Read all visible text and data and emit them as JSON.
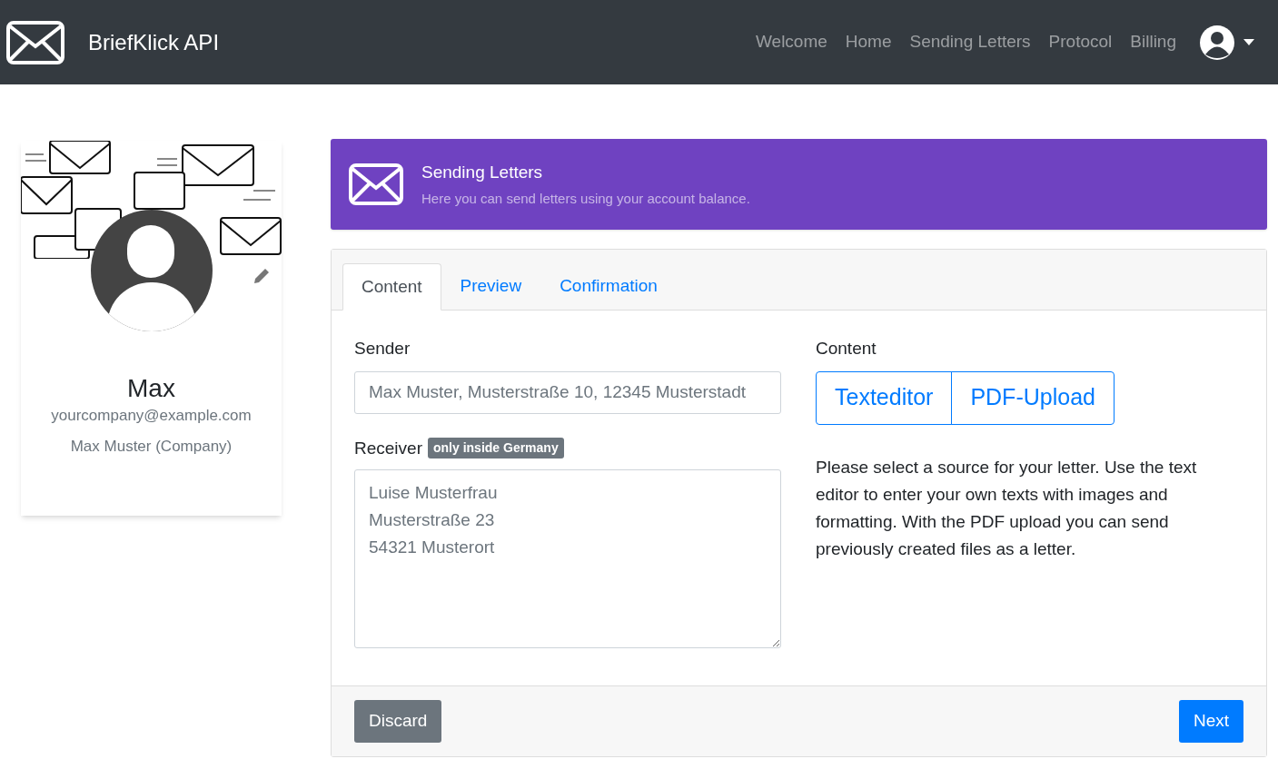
{
  "navbar": {
    "brand": "BriefKlick API",
    "links": [
      "Welcome",
      "Home",
      "Sending Letters",
      "Protocol",
      "Billing"
    ]
  },
  "profile": {
    "name": "Max",
    "email": "yourcompany@example.com",
    "company": "Max Muster (Company)"
  },
  "banner": {
    "title": "Sending Letters",
    "subtitle": "Here you can send letters using your account balance."
  },
  "tabs": [
    {
      "label": "Content",
      "selected": true
    },
    {
      "label": "Preview",
      "selected": false
    },
    {
      "label": "Confirmation",
      "selected": false
    }
  ],
  "form": {
    "sender": {
      "label": "Sender",
      "placeholder": "Max Muster, Musterstraße 10, 12345 Musterstadt"
    },
    "receiver": {
      "label": "Receiver",
      "badge": "only inside Germany",
      "placeholder": "Luise Musterfrau\nMusterstraße 23\n54321 Musterort"
    }
  },
  "content": {
    "label": "Content",
    "options": [
      "Texteditor",
      "PDF-Upload"
    ],
    "help": "Please select a source for your letter. Use the text editor to enter your own texts with images and formatting. With the PDF upload you can send previously created files as a letter."
  },
  "buttons": {
    "discard": "Discard",
    "next": "Next"
  }
}
